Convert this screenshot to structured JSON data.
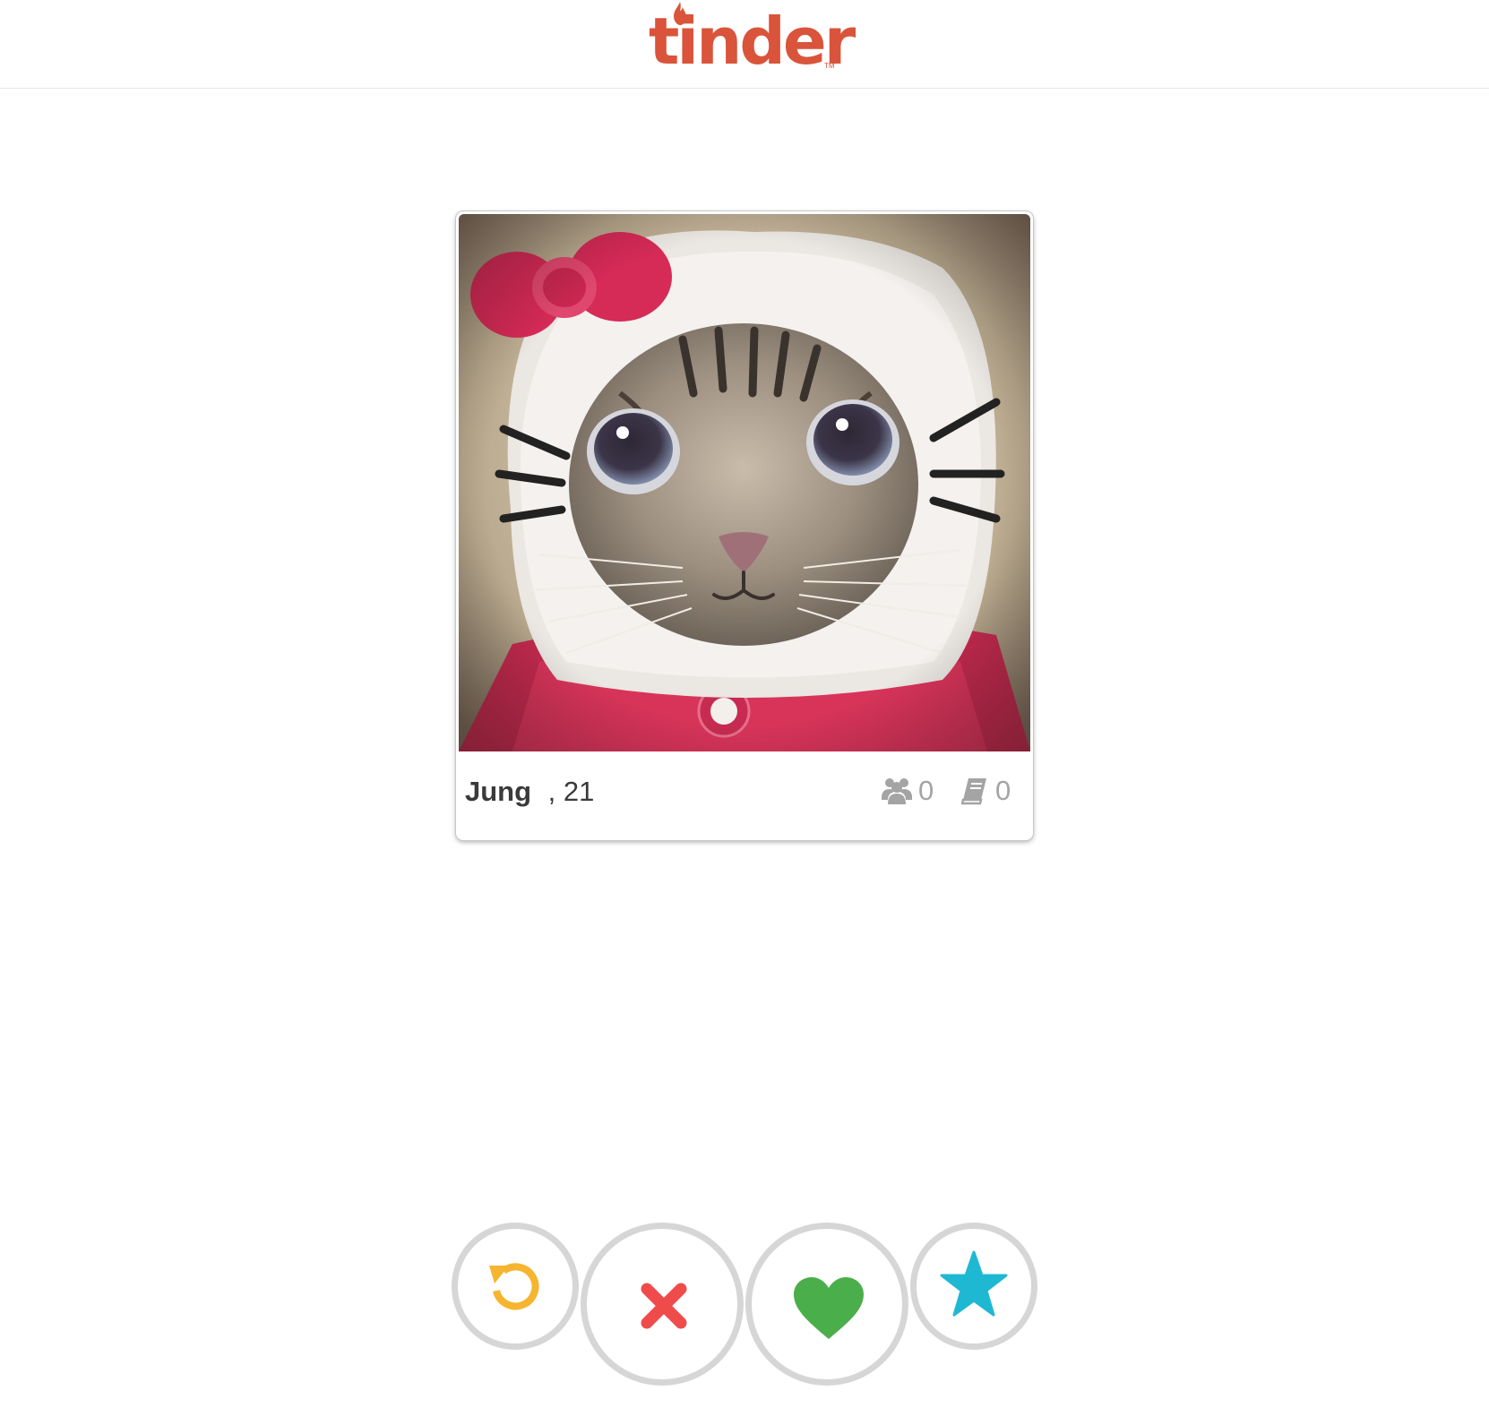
{
  "header": {
    "logo_text": "tinder",
    "logo_tm": "TM",
    "brand_color": "#d9543a"
  },
  "profile": {
    "name": "Jung",
    "age_text": " , 21",
    "common_friends": "0",
    "common_interests": "0",
    "photo_subject": "cat wearing hello kitty hood"
  },
  "actions": {
    "undo": {
      "icon": "undo-icon",
      "color": "#f5b52e"
    },
    "nope": {
      "icon": "x-icon",
      "color": "#f04b4b"
    },
    "like": {
      "icon": "heart-icon",
      "color": "#4aae4a"
    },
    "super_like": {
      "icon": "star-icon",
      "color": "#1fb8d3"
    }
  }
}
